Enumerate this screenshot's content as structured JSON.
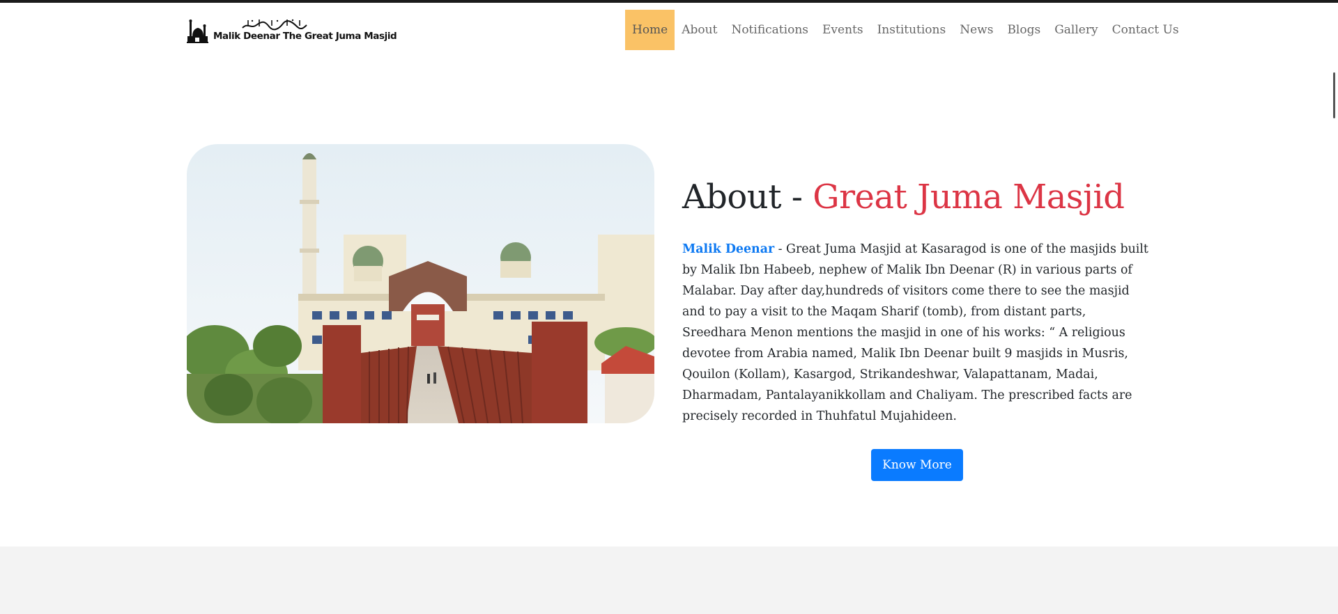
{
  "header": {
    "logo_text": "Malik Deenar The Great Juma Masjid",
    "nav": [
      {
        "label": "Home",
        "active": true
      },
      {
        "label": "About"
      },
      {
        "label": "Notifications"
      },
      {
        "label": "Events"
      },
      {
        "label": "Institutions"
      },
      {
        "label": "News"
      },
      {
        "label": "Blogs"
      },
      {
        "label": "Gallery"
      },
      {
        "label": "Contact Us"
      }
    ]
  },
  "about": {
    "title_prefix": "About - ",
    "title_accent": "Great Juma Masjid",
    "link_text": "Malik Deenar",
    "body": " - Great Juma Masjid at Kasaragod is one of the masjids built by Malik Ibn Habeeb, nephew of Malik Ibn Deenar (R) in various parts of Malabar. Day after day,hundreds of visitors come there to see the masjid and to pay a visit to the Maqam Sharif (tomb), from distant parts, Sreedhara Menon mentions the masjid in one of his works: “ A religious devotee from Arabia named, Malik Ibn Deenar built 9 masjids in Musris, Qouilon (Kollam), Kasargod, Strikandeshwar, Valapattanam, Madai, Dharmadam, Pantalayanikkollam and Chaliyam. The prescribed facts are precisely recorded in Thuhfatul Mujahideen.",
    "button_label": "Know More"
  },
  "colors": {
    "nav_active_bg": "#fac266",
    "title_accent": "#dc3545",
    "link": "#0d79f2",
    "button_bg": "#0a7bff",
    "footer_band": "#f3f3f3"
  },
  "icons": {
    "logo_emblem": "mosque-emblem-icon",
    "logo_calligraphy": "arabic-calligraphy-icon"
  }
}
